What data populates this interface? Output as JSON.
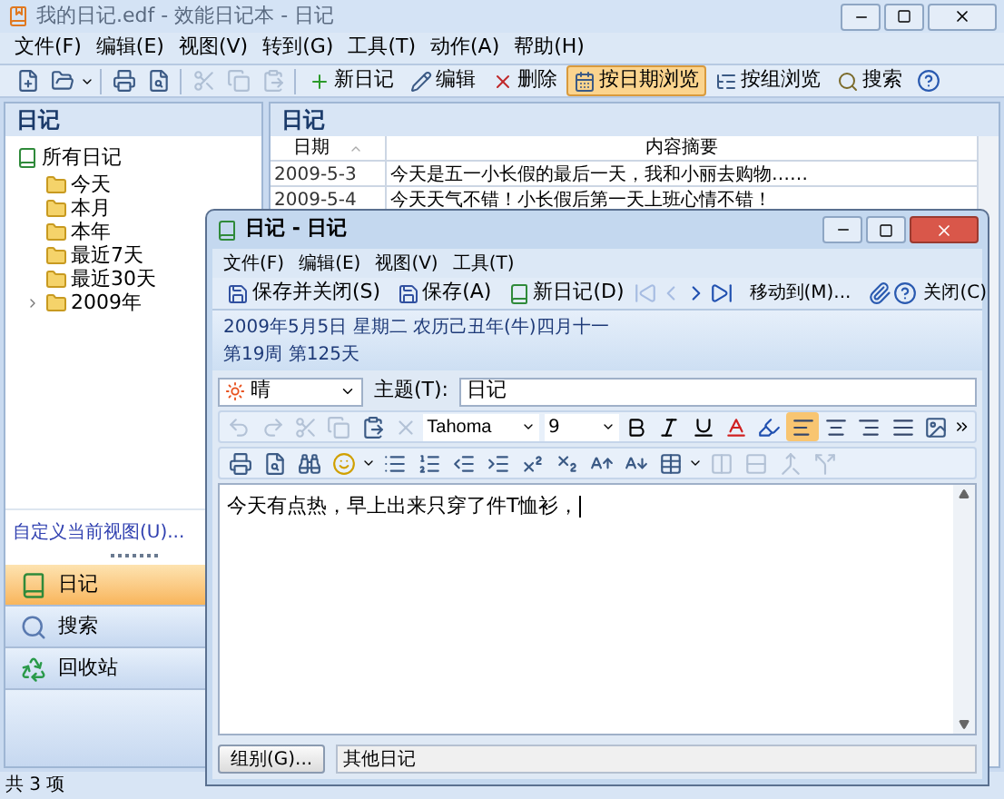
{
  "window": {
    "title": "我的日记.edf - 效能日记本 - 日记"
  },
  "menu": [
    "文件(F)",
    "编辑(E)",
    "视图(V)",
    "转到(G)",
    "工具(T)",
    "动作(A)",
    "帮助(H)"
  ],
  "toolbar": {
    "tools": [
      {
        "disabled": false
      },
      {
        "disabled": false
      },
      {
        "disabled": false
      },
      {
        "disabled": false
      },
      {
        "disabled": true
      },
      {
        "disabled": true
      },
      {
        "disabled": true
      }
    ],
    "buttons": [
      {
        "label": "新日记",
        "selected": false
      },
      {
        "label": "编辑",
        "selected": false
      },
      {
        "label": "删除",
        "selected": false
      },
      {
        "label": "按日期浏览",
        "selected": true
      },
      {
        "label": "按组浏览",
        "selected": false
      },
      {
        "label": "搜索",
        "selected": false
      }
    ]
  },
  "sidebar": {
    "title": "日记",
    "tree": {
      "label": "所有日记",
      "children": [
        {
          "label": "今天"
        },
        {
          "label": "本月"
        },
        {
          "label": "本年"
        },
        {
          "label": "最近7天"
        },
        {
          "label": "最近30天"
        },
        {
          "label": "2009年",
          "expanded": false
        }
      ]
    },
    "customize_link": "自定义当前视图(U)...",
    "nav": [
      {
        "label": "日记",
        "selected": true
      },
      {
        "label": "搜索",
        "selected": false
      },
      {
        "label": "回收站",
        "selected": false
      }
    ]
  },
  "list": {
    "title": "日记",
    "columns": [
      "日期",
      "内容摘要"
    ],
    "rows": [
      {
        "date": "2009-5-3",
        "summary": "今天是五一小长假的最后一天，我和小丽去购物……"
      },
      {
        "date": "2009-5-4",
        "summary": "今天天气不错！小长假后第一天上班心情不错！"
      }
    ]
  },
  "status_bar": "共 3 项",
  "editor_window": {
    "title": "日记 - 日记",
    "menu": [
      "文件(F)",
      "编辑(E)",
      "视图(V)",
      "工具(T)"
    ],
    "toolbar": {
      "save_close": "保存并关闭(S)",
      "save": "保存(A)",
      "new": "新日记(D)",
      "nav": [
        {
          "disabled": true
        },
        {
          "disabled": true
        },
        {
          "disabled": false
        },
        {
          "disabled": false
        }
      ],
      "move": "移动到(M)...",
      "close": "关闭(C)"
    },
    "date_line": "2009年5月5日 星期二 农历己丑年(牛)四月十一",
    "week_line": "第19周 第125天",
    "weather": "晴",
    "subject_label": "主题(T):",
    "subject": "日记",
    "format": {
      "font": "Tahoma",
      "size": "9",
      "edit_tools": [
        {
          "disabled": true
        },
        {
          "disabled": true
        },
        {
          "disabled": true
        },
        {
          "disabled": true
        },
        {
          "disabled": false
        },
        {
          "disabled": true
        }
      ],
      "align": [
        {
          "selected": true
        },
        {
          "selected": false
        },
        {
          "selected": false
        },
        {
          "selected": false
        }
      ]
    },
    "body": "今天有点热，早上出来只穿了件T恤衫，",
    "group_button": "组别(G)...",
    "group": "其他日记"
  }
}
